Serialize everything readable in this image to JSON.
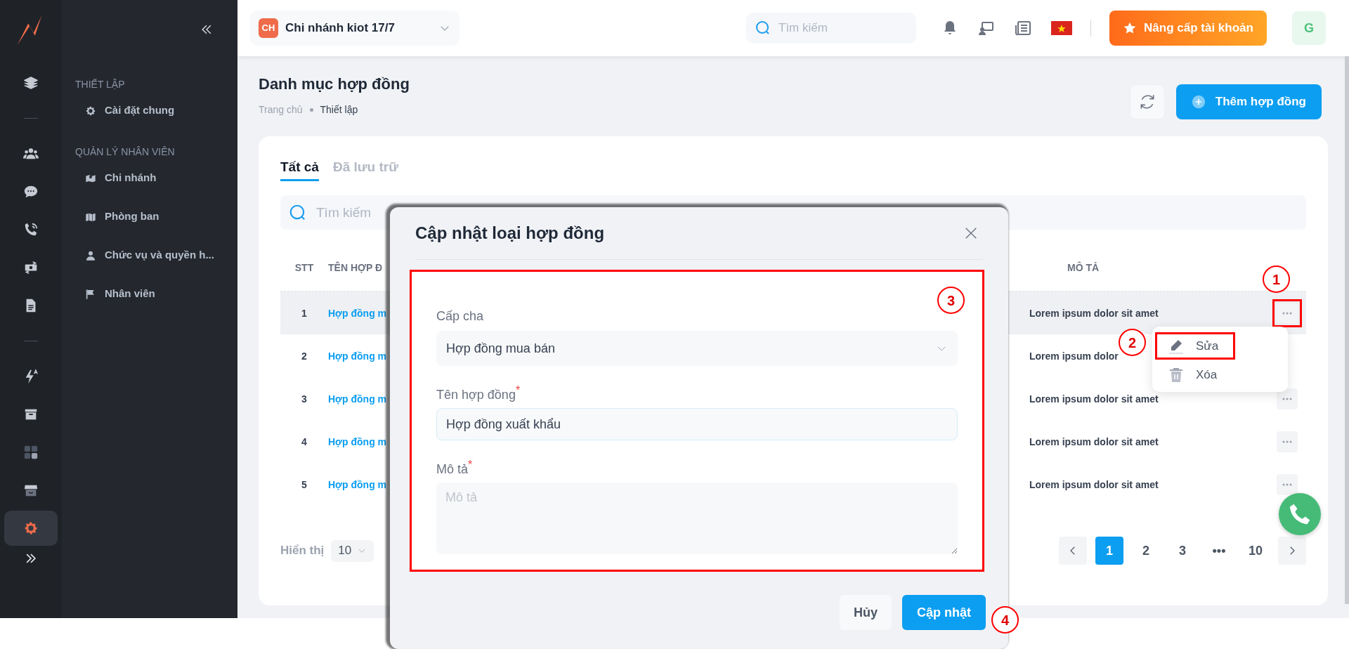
{
  "rail": {
    "groups": [
      {
        "items": [
          {
            "kind": "layers",
            "selected": false
          }
        ]
      },
      {
        "items": [
          {
            "kind": "users",
            "selected": false
          },
          {
            "kind": "chat",
            "selected": false
          },
          {
            "kind": "phone",
            "selected": false
          },
          {
            "kind": "money",
            "selected": false
          },
          {
            "kind": "document",
            "selected": false
          }
        ]
      },
      {
        "items": [
          {
            "kind": "bolt",
            "selected": false
          },
          {
            "kind": "archive",
            "selected": false
          },
          {
            "kind": "grid",
            "selected": false
          },
          {
            "kind": "store",
            "selected": false
          },
          {
            "kind": "gear",
            "selected": true
          }
        ]
      }
    ]
  },
  "sidebar": {
    "sections": [
      {
        "title": "THIẾT LẬP",
        "items": [
          {
            "label": "Cài đặt chung",
            "kind": "gear"
          }
        ]
      },
      {
        "title": "QUẢN LÝ NHÂN VIÊN",
        "items": [
          {
            "label": "Chi nhánh",
            "kind": "map-pin"
          },
          {
            "label": "Phòng ban",
            "kind": "map"
          },
          {
            "label": "Chức vụ và quyền h...",
            "kind": "user"
          },
          {
            "label": "Nhân viên",
            "kind": "flag"
          }
        ]
      }
    ]
  },
  "topbar": {
    "branch": {
      "badge": "CH",
      "name": "Chi nhánh kiot 17/7"
    },
    "search": {
      "placeholder": "Tìm kiếm"
    },
    "upgrade_button": "Nâng cấp tài khoản",
    "avatar": "G"
  },
  "page": {
    "title": "Danh mục hợp đồng",
    "breadcrumb": [
      "Trang chủ",
      "Thiết lập"
    ],
    "add_button": "Thêm hợp đồng"
  },
  "tabs": [
    {
      "label": "Tất cả",
      "selected": true
    },
    {
      "label": "Đã lưu trữ",
      "selected": false
    }
  ],
  "search": {
    "placeholder": "Tìm kiếm"
  },
  "table": {
    "columns": [
      "STT",
      "TÊN HỢP Đ",
      "MÔ TẢ"
    ],
    "rows": [
      {
        "stt": "1",
        "name": "Hợp đồng m",
        "description": "Lorem ipsum dolor sit amet",
        "selected": true,
        "action_button": true
      },
      {
        "stt": "2",
        "name": "Hợp đồng m",
        "description": "Lorem ipsum dolor",
        "selected": false,
        "action_button": false
      },
      {
        "stt": "3",
        "name": "Hợp đồng m",
        "description": "Lorem ipsum dolor sit amet",
        "selected": false,
        "action_button": true
      },
      {
        "stt": "4",
        "name": "Hợp đồng m",
        "description": "Lorem ipsum dolor sit amet",
        "selected": false,
        "action_button": true
      },
      {
        "stt": "5",
        "name": "Hợp đồng m",
        "description": "Lorem ipsum dolor sit amet",
        "selected": false,
        "action_button": true
      }
    ]
  },
  "pagination": {
    "page_size_label": "Hiển thị",
    "page_size": "10",
    "pages": [
      {
        "label": "1",
        "selected": true
      },
      {
        "label": "2",
        "selected": false
      },
      {
        "label": "3",
        "selected": false
      },
      {
        "label": "•••",
        "selected": false
      },
      {
        "label": "10",
        "selected": false
      }
    ]
  },
  "row_menu": [
    {
      "label": "Sửa",
      "kind": "edit"
    },
    {
      "label": "Xóa",
      "kind": "delete"
    }
  ],
  "modal": {
    "title": "Cập nhật loại hợp đồng",
    "fields": [
      {
        "kind": "select",
        "label": "Cấp cha",
        "value": "Hợp đồng mua bán"
      },
      {
        "kind": "text",
        "label": "Tên hợp đồng",
        "value": "Hợp đồng xuất khẩu",
        "required_mark": "*"
      },
      {
        "kind": "textarea",
        "label": "Mô tả",
        "placeholder": "Mô tả",
        "required_mark": "*"
      }
    ],
    "cancel_button": "Hủy",
    "submit_button": "Cập nhật"
  },
  "annotations": [
    {
      "label": "1",
      "framed": true
    },
    {
      "label": "2",
      "framed": true
    },
    {
      "label": "3",
      "framed": true
    },
    {
      "label": "4",
      "framed": false
    }
  ]
}
